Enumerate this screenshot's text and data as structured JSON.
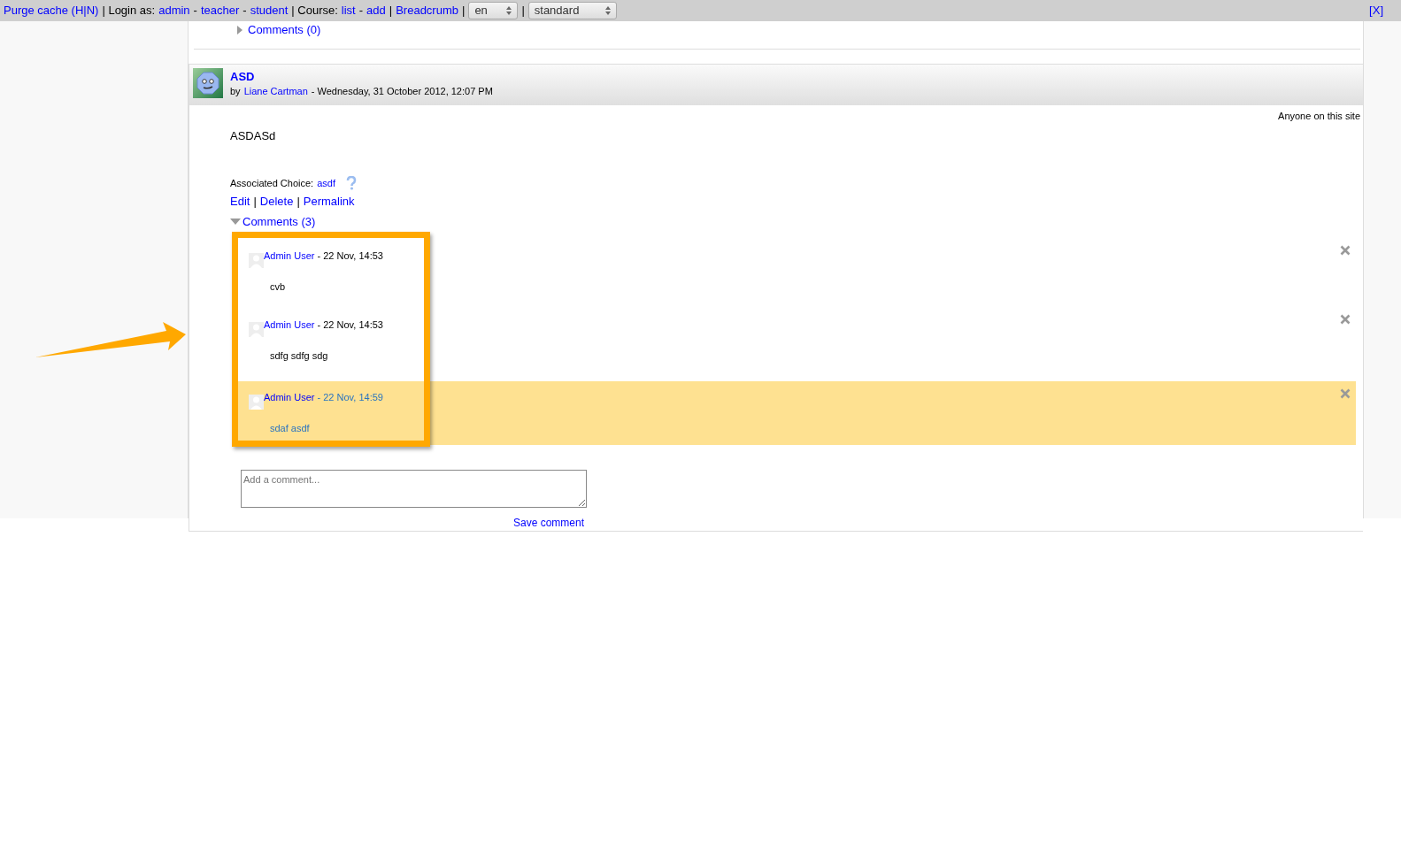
{
  "toolbar": {
    "segments": [
      {
        "kind": "link",
        "text": "Purge cache (H|N)"
      },
      {
        "kind": "text",
        "text": "| Login as:"
      },
      {
        "kind": "link",
        "text": "admin"
      },
      {
        "kind": "text",
        "text": "-"
      },
      {
        "kind": "link",
        "text": "teacher"
      },
      {
        "kind": "text",
        "text": "-"
      },
      {
        "kind": "link",
        "text": "student"
      },
      {
        "kind": "text",
        "text": "| Course:"
      },
      {
        "kind": "link",
        "text": "list"
      },
      {
        "kind": "text",
        "text": "-"
      },
      {
        "kind": "link",
        "text": "add"
      },
      {
        "kind": "text",
        "text": "|"
      },
      {
        "kind": "link",
        "text": "Breadcrumb"
      },
      {
        "kind": "text",
        "text": "|"
      },
      {
        "kind": "select",
        "text": "en"
      },
      {
        "kind": "text",
        "text": "|"
      },
      {
        "kind": "select",
        "text": "standard"
      }
    ],
    "close": "[X]"
  },
  "previous_post": {
    "comments_toggle": {
      "label": "Comments (0)",
      "expanded": false
    }
  },
  "post": {
    "title": "ASD",
    "by": "by",
    "author": "Liane Cartman",
    "date": "- Wednesday, 31 October 2012, 12:07 PM",
    "visibility": "Anyone on this site",
    "body": "ASDASd",
    "associated_label": "Associated Choice:",
    "associated_link": "asdf",
    "actions": [
      "Edit",
      "Delete",
      "Permalink"
    ],
    "action_separator": "|",
    "comments_toggle": {
      "label": "Comments (3)",
      "expanded": true
    },
    "comments": [
      {
        "author": "Admin User",
        "date": "- 22 Nov, 14:53",
        "text": "cvb",
        "selected": false
      },
      {
        "author": "Admin User",
        "date": "- 22 Nov, 14:53",
        "text": "sdfg sdfg sdg",
        "selected": false
      },
      {
        "author": "Admin User",
        "date": "- 22 Nov, 14:59",
        "text": "sdaf asdf",
        "selected": true
      }
    ],
    "comment_field": {
      "placeholder": "Add a comment..."
    },
    "save_button": "Save comment"
  }
}
